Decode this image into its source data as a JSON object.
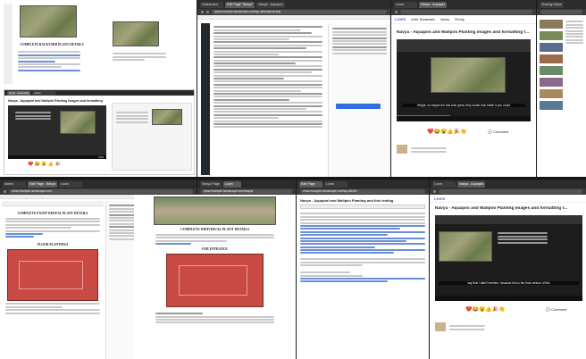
{
  "windows": {
    "w1": {
      "tabs": [
        "Docs - Assembly",
        "Editor"
      ],
      "doc_title": "COMPLETE BACKYARD PLANT DETAILS",
      "caption": "Navya - Aquapini and Wallpini Planting images and formatting",
      "caption_time": "3:01"
    },
    "w2": {
      "tabs": [
        "Dashboard",
        "Edit Page \"Navya\"",
        "Navya - Aquapini"
      ],
      "url": "www.example-landscape.com/wp-admin/post.php"
    },
    "w3": {
      "tabs": [
        "Loom",
        "Navya - Aquapini",
        "Loom"
      ],
      "title": "Navya - Aquapini and Wallpini Planting images and formatting f...",
      "subtitle": "Wright, so maybe the this look great, they would look better if you could",
      "nav": [
        "Loom",
        "Invite Teammates",
        "Library",
        "Pricing"
      ],
      "comment_label": "Comment"
    },
    "w4": {
      "tabs": [
        "Sharing Stripe",
        "Alt Ridge"
      ]
    },
    "w5": {
      "tabs": [
        "Admin",
        "Edit Page - Navya",
        "Loom"
      ],
      "heading": "COMPLETE ENJOY DEDUAL PLANT DETAILS",
      "subheading": "FLOOR PLANTINGS",
      "url": "www.example-landscape.com"
    },
    "w6": {
      "tabs": [
        "Navya Page",
        "Loom",
        "Edit Ridge"
      ],
      "heading": "COMPLETE INDIVIDUAL PLANT DETAILS",
      "subheading": "FOR ENTRANCE",
      "url": "www.example-landscape.com/navya"
    },
    "w7": {
      "tabs": [
        "Edit Page",
        "Loom",
        "Edit Ridge"
      ],
      "title": "Navya - Aquapini and Wallpini Planting and this testing",
      "url": "www.example-landscape.com/wp-admin"
    },
    "w8": {
      "tabs": [
        "Loom",
        "Navya - Aquapini",
        "Loom"
      ],
      "title": "Navya - Aquapini and Wallpini Planting images and formatting f...",
      "subtitle": "say that I didn't mention, because this is the final version of this",
      "comment_label": "Comment"
    }
  },
  "colors": {
    "accent_blue": "#2f6fde",
    "loom_purple": "#625df5",
    "plan_red": "#c94a44"
  }
}
